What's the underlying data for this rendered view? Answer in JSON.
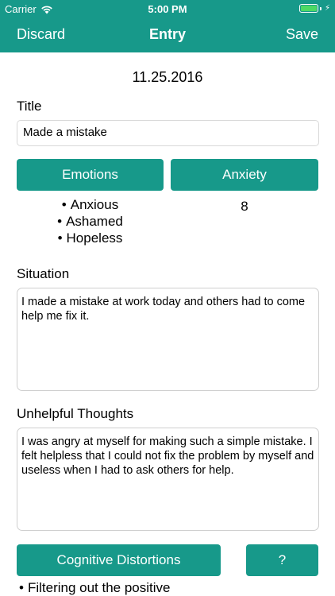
{
  "status_bar": {
    "carrier": "Carrier",
    "time": "5:00 PM",
    "battery_color": "#4cd964"
  },
  "navbar": {
    "left": "Discard",
    "title": "Entry",
    "right": "Save",
    "color": "#17998a"
  },
  "entry": {
    "date": "11.25.2016",
    "title_label": "Title",
    "title_value": "Made a mistake",
    "emotions_button": "Emotions",
    "anxiety_button": "Anxiety",
    "emotions": [
      "Anxious",
      "Ashamed",
      "Hopeless"
    ],
    "anxiety_value": "8",
    "situation_label": "Situation",
    "situation_text": "I made a mistake at work today and others had to come help me fix it.",
    "thoughts_label": "Unhelpful Thoughts",
    "thoughts_text": "I was angry at myself for making such a simple mistake. I felt helpless that I could not fix the problem by myself and useless when I had to ask others for help.",
    "distortions_button": "Cognitive Distortions",
    "help_button": "?",
    "distortions": [
      "Filtering out the positive"
    ]
  }
}
